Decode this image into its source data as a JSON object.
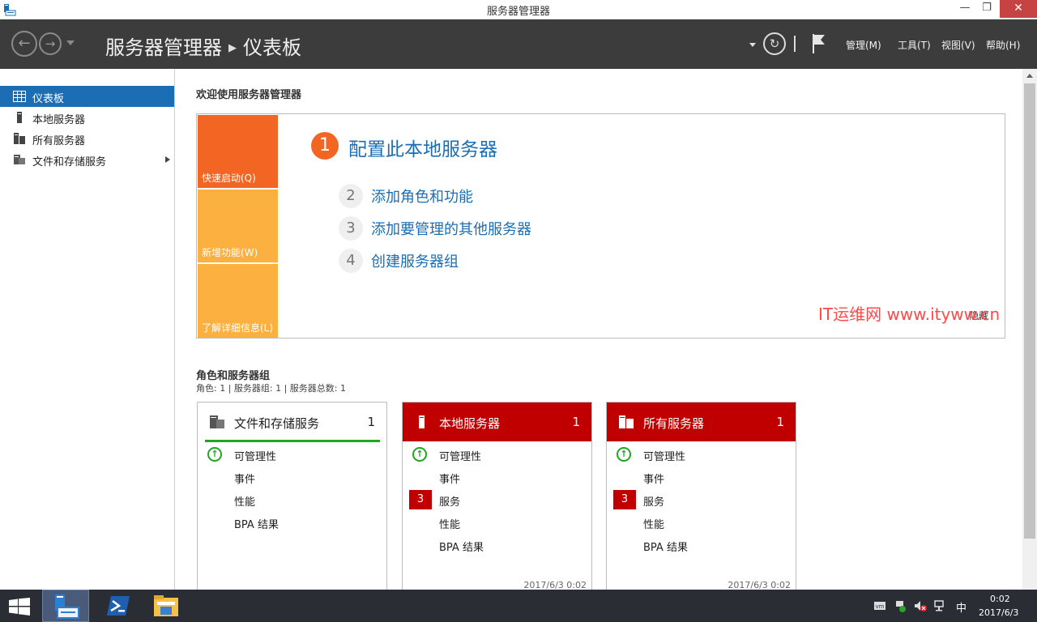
{
  "window": {
    "title": "服务器管理器",
    "minimize": "—",
    "maximize": "❐",
    "close": "✕"
  },
  "header": {
    "breadcrumb_root": "服务器管理器",
    "breadcrumb_sep": "▶",
    "breadcrumb_current": "仪表板",
    "menu": {
      "manage": "管理(M)",
      "tools": "工具(T)",
      "view": "视图(V)",
      "help": "帮助(H)"
    }
  },
  "sidebar": {
    "items": [
      {
        "label": "仪表板",
        "icon": "dashboard-icon",
        "active": true
      },
      {
        "label": "本地服务器",
        "icon": "server-icon"
      },
      {
        "label": "所有服务器",
        "icon": "servers-icon"
      },
      {
        "label": "文件和存储服务",
        "icon": "file-storage-icon"
      }
    ]
  },
  "welcome": {
    "title": "欢迎使用服务器管理器",
    "tiles": {
      "quick_start": "快速启动(Q)",
      "whats_new": "新增功能(W)",
      "learn_more": "了解详细信息(L)"
    },
    "steps": [
      {
        "num": "1",
        "text": "配置此本地服务器"
      },
      {
        "num": "2",
        "text": "添加角色和功能"
      },
      {
        "num": "3",
        "text": "添加要管理的其他服务器"
      },
      {
        "num": "4",
        "text": "创建服务器组"
      }
    ],
    "hide": "隐藏"
  },
  "roles": {
    "title": "角色和服务器组",
    "subtitle": "角色: 1 | 服务器组: 1 | 服务器总数: 1",
    "cards": [
      {
        "title": "文件和存储服务",
        "count": "1",
        "rows": [
          "可管理性",
          "事件",
          "性能",
          "BPA 结果"
        ]
      },
      {
        "title": "本地服务器",
        "count": "1",
        "rows": [
          "可管理性",
          "事件",
          "服务",
          "性能",
          "BPA 结果"
        ],
        "badge": "3",
        "timestamp": "2017/6/3 0:02"
      },
      {
        "title": "所有服务器",
        "count": "1",
        "rows": [
          "可管理性",
          "事件",
          "服务",
          "性能",
          "BPA 结果"
        ],
        "badge": "3",
        "timestamp": "2017/6/3 0:02"
      }
    ]
  },
  "watermark": "IT运维网 www.ityww.cn",
  "taskbar": {
    "ime": "中",
    "time": "0:02",
    "date": "2017/6/3"
  },
  "colors": {
    "accent": "#1b6eb3",
    "header": "#3c3c3c",
    "quick_start_tile": "#f26522",
    "tile_orange": "#fbb040",
    "alert_red": "#c00000",
    "ok_green": "#1fa81f",
    "taskbar": "#2b2d34"
  }
}
